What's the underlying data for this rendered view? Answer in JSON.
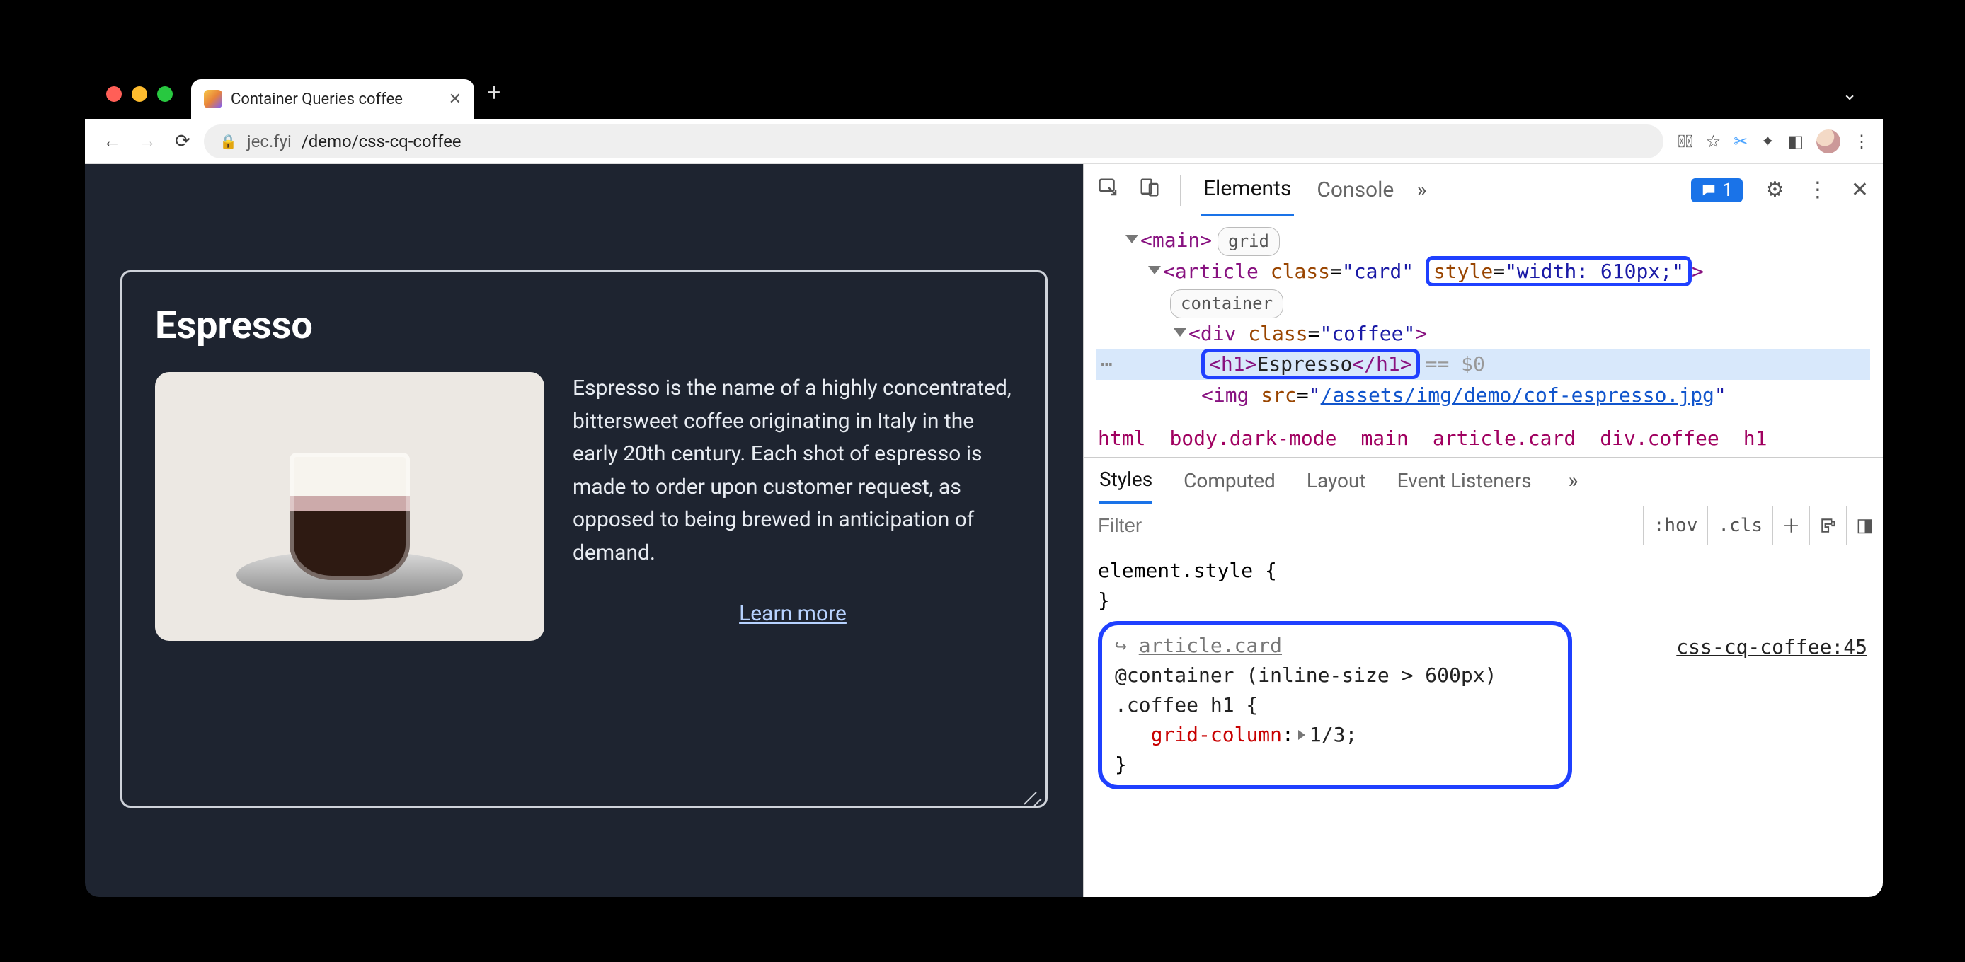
{
  "window": {
    "tab_title": "Container Queries coffee",
    "url_host": "jec.fyi",
    "url_path": "/demo/css-cq-coffee"
  },
  "page": {
    "heading": "Espresso",
    "description": "Espresso is the name of a highly concentrated, bittersweet coffee originating in Italy in the early 20th century. Each shot of espresso is made to order upon customer request, as opposed to being brewed in anticipation of demand.",
    "learn_more": "Learn more"
  },
  "devtools": {
    "tabs": {
      "elements": "Elements",
      "console": "Console"
    },
    "issues_count": "1",
    "dom": {
      "main_tag": "main",
      "main_badge": "grid",
      "article_open": "article",
      "article_class_attr": "class",
      "article_class_val": "card",
      "article_style_attr": "style",
      "article_style_val": "width: 610px;",
      "article_badge": "container",
      "div_tag": "div",
      "div_class_attr": "class",
      "div_class_val": "coffee",
      "h1_tag": "h1",
      "h1_text": "Espresso",
      "eq0": "== $0",
      "img_tag": "img",
      "img_src_attr": "src",
      "img_src_val": "/assets/img/demo/cof-espresso.jpg"
    },
    "breadcrumbs": [
      "html",
      "body.dark-mode",
      "main",
      "article.card",
      "div.coffee",
      "h1"
    ],
    "styles_tabs": {
      "styles": "Styles",
      "computed": "Computed",
      "layout": "Layout",
      "listeners": "Event Listeners"
    },
    "filter_placeholder": "Filter",
    "filter_pills": {
      "hov": ":hov",
      "cls": ".cls"
    },
    "styles": {
      "element_style": "element.style {",
      "brace_close": "}",
      "container_target": "article.card",
      "container_query": "@container (inline-size > 600px)",
      "selector": ".coffee h1 {",
      "prop": "grid-column",
      "val": "1/3;",
      "source": "css-cq-coffee:45",
      "arrow": "↪"
    }
  }
}
